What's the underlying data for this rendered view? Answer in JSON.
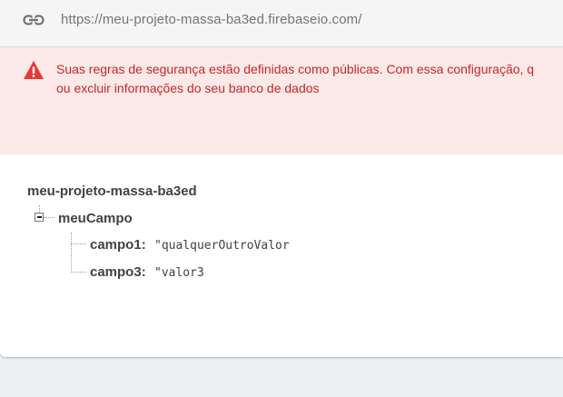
{
  "url_bar": {
    "link_icon": "link-icon",
    "url": "https://meu-projeto-massa-ba3ed.firebaseio.com/"
  },
  "alert": {
    "icon": "warning-icon",
    "line1": "Suas regras de segurança estão definidas como públicas. Com essa configuração, q",
    "line2": "ou excluir informações do seu banco de dados",
    "text_color": "#c62828",
    "background": "#fbe9e7"
  },
  "tree": {
    "root": "meu-projeto-massa-ba3ed",
    "child": {
      "name": "meuCampo",
      "fields": [
        {
          "key": "campo1:",
          "value": "\"qualquerOutroValor"
        },
        {
          "key": "campo3:",
          "value": "\"valor3"
        }
      ]
    }
  }
}
